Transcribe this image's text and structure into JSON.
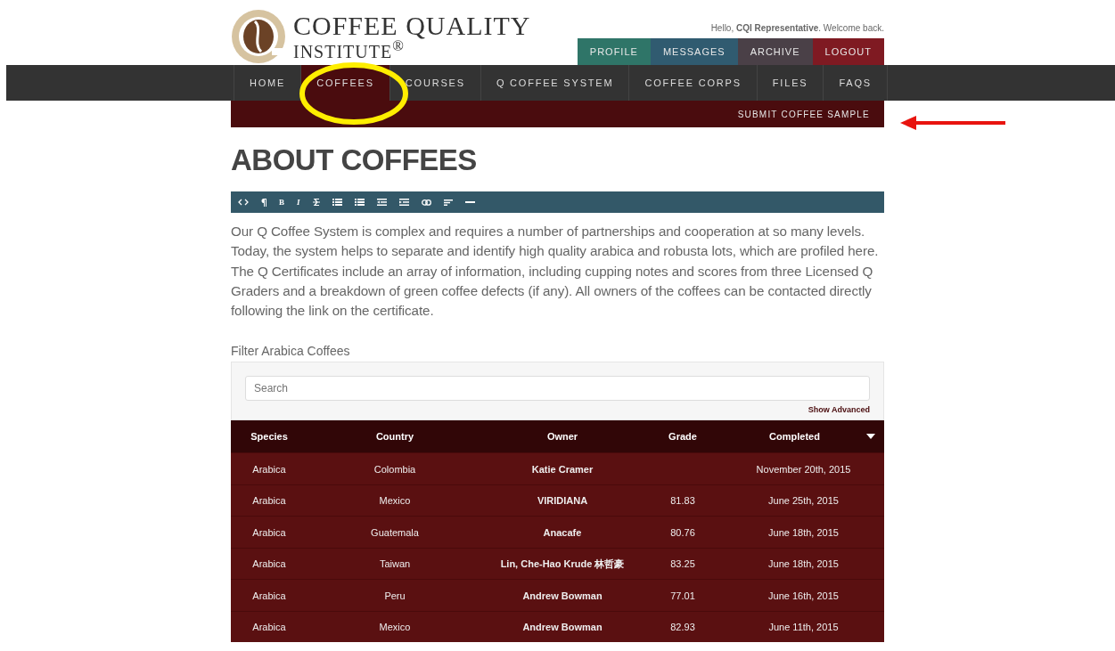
{
  "logo": {
    "line_1": "COFFEE QUALITY",
    "line_2": "INSTITUTE$^{®}$"
  },
  "greeting": "Hello, **CQI Representative**. Welcome back.",
  "account_buttons": [
    {
      "label": "PROFILE",
      "color": "#2f7568"
    },
    {
      "label": "MESSAGES",
      "color": "#305b70"
    },
    {
      "label": "ARCHIVE",
      "color": "#4a4047"
    },
    {
      "label": "LOGOUT",
      "color": "#7f1a22"
    }
  ],
  "nav": [
    {
      "label": "HOME",
      "selected": false
    },
    {
      "label": "COFFEES",
      "selected": true
    },
    {
      "label": "COURSES",
      "selected": false
    },
    {
      "label": "Q COFFEE SYSTEM",
      "selected": false
    },
    {
      "label": "COFFEE CORPS",
      "selected": false
    },
    {
      "label": "FILES",
      "selected": false
    },
    {
      "label": "FAQS",
      "selected": false
    }
  ],
  "subnav": {
    "link": "SUBMIT COFFEE SAMPLE"
  },
  "heading": "ABOUT COFFEES",
  "editor_toolbar": [
    {
      "kind": "code"
    },
    {
      "kind": "paragraph"
    },
    {
      "kind": "letter",
      "label": "B"
    },
    {
      "kind": "letter",
      "label": "I"
    },
    {
      "kind": "strike"
    },
    {
      "kind": "bullets"
    },
    {
      "kind": "numbers"
    },
    {
      "kind": "outdent"
    },
    {
      "kind": "indent"
    },
    {
      "kind": "link"
    },
    {
      "kind": "align"
    },
    {
      "kind": "rule"
    }
  ],
  "intro": "Our Q Coffee System is complex and requires a number of partnerships and cooperation at so many levels. Today, the system helps to separate and identify high quality arabica and robusta lots, which are profiled here. The Q Certificates include an array of information, including cupping notes and scores from three Licensed Q Graders and a breakdown of green coffee defects (if any). All owners of the coffees can be contacted directly following the link on the certificate.",
  "filter": {
    "label": "Filter Arabica Coffees",
    "search": {
      "placeholder": "Search"
    },
    "advanced_link": "Show Advanced"
  },
  "table": {
    "columns": [
      "Species",
      "Country",
      "Owner",
      "Grade",
      "Completed"
    ],
    "rows": [
      [
        "Arabica",
        "Colombia",
        "Katie Cramer",
        "",
        "November 20th, 2015"
      ],
      [
        "Arabica",
        "Mexico",
        "VIRIDIANA",
        "81.83",
        "June 25th, 2015"
      ],
      [
        "Arabica",
        "Guatemala",
        "Anacafe",
        "80.76",
        "June 18th, 2015"
      ],
      [
        "Arabica",
        "Taiwan",
        "Lin, Che-Hao Krude 林哲豪",
        "83.25",
        "June 18th, 2015"
      ],
      [
        "Arabica",
        "Peru",
        "Andrew Bowman",
        "77.01",
        "June 16th, 2015"
      ],
      [
        "Arabica",
        "Mexico",
        "Andrew Bowman",
        "82.93",
        "June 11th, 2015"
      ]
    ]
  }
}
